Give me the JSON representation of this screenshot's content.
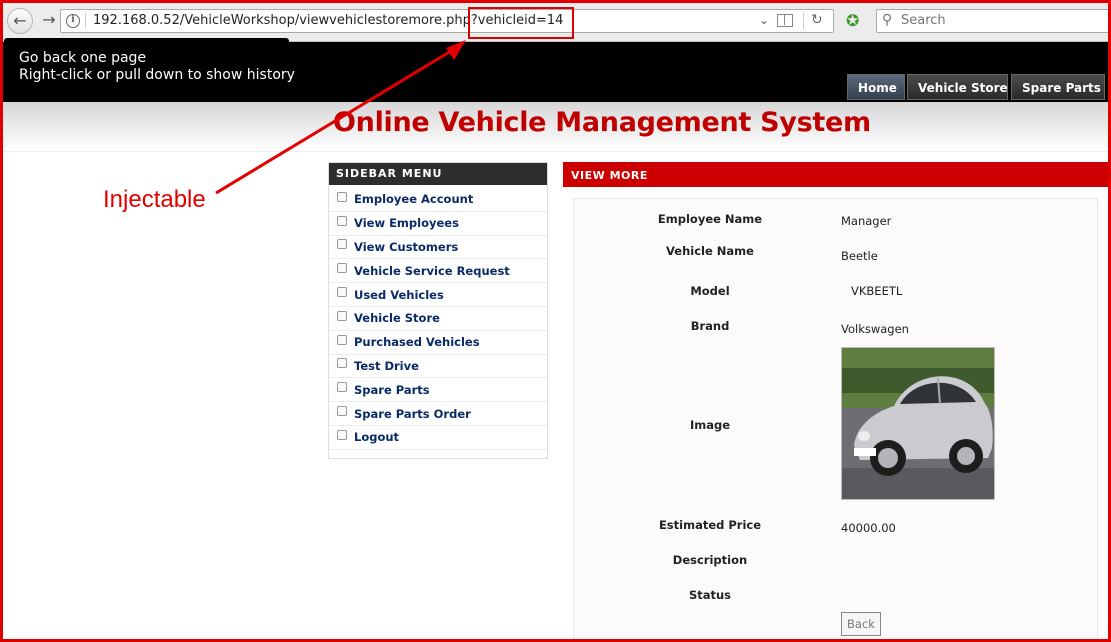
{
  "browser": {
    "url": "192.168.0.52/VehicleWorkshop/viewvehiclestoremore.php?vehicleid=14",
    "search_placeholder": "Search",
    "tooltip": {
      "line1": "Go back one page",
      "line2": "Right-click or pull down to show history"
    }
  },
  "site": {
    "title": "Online Vehicle Management System",
    "nav": [
      "Home",
      "Vehicle Store",
      "Spare Parts"
    ]
  },
  "sidebar": {
    "heading": "SIDEBAR MENU",
    "items": [
      "Employee Account",
      "View Employees",
      "View Customers",
      "Vehicle Service Request",
      "Used Vehicles",
      "Vehicle Store",
      "Purchased Vehicles",
      "Test Drive",
      "Spare Parts",
      "Spare Parts Order",
      "Logout"
    ]
  },
  "view_more": {
    "heading": "VIEW MORE",
    "fields": {
      "employee_name": {
        "label": "Employee Name",
        "value": "Manager"
      },
      "vehicle_name": {
        "label": "Vehicle Name",
        "value": "Beetle"
      },
      "model": {
        "label": "Model",
        "value": "VKBEETL"
      },
      "brand": {
        "label": "Brand",
        "value": "Volkswagen"
      },
      "image": {
        "label": "Image"
      },
      "estimated_price": {
        "label": "Estimated Price",
        "value": "40000.00"
      },
      "description": {
        "label": "Description",
        "value": ""
      },
      "status": {
        "label": "Status",
        "value": ""
      }
    },
    "back_label": "Back"
  },
  "annotation": {
    "label": "Injectable",
    "color": "#e00000"
  }
}
